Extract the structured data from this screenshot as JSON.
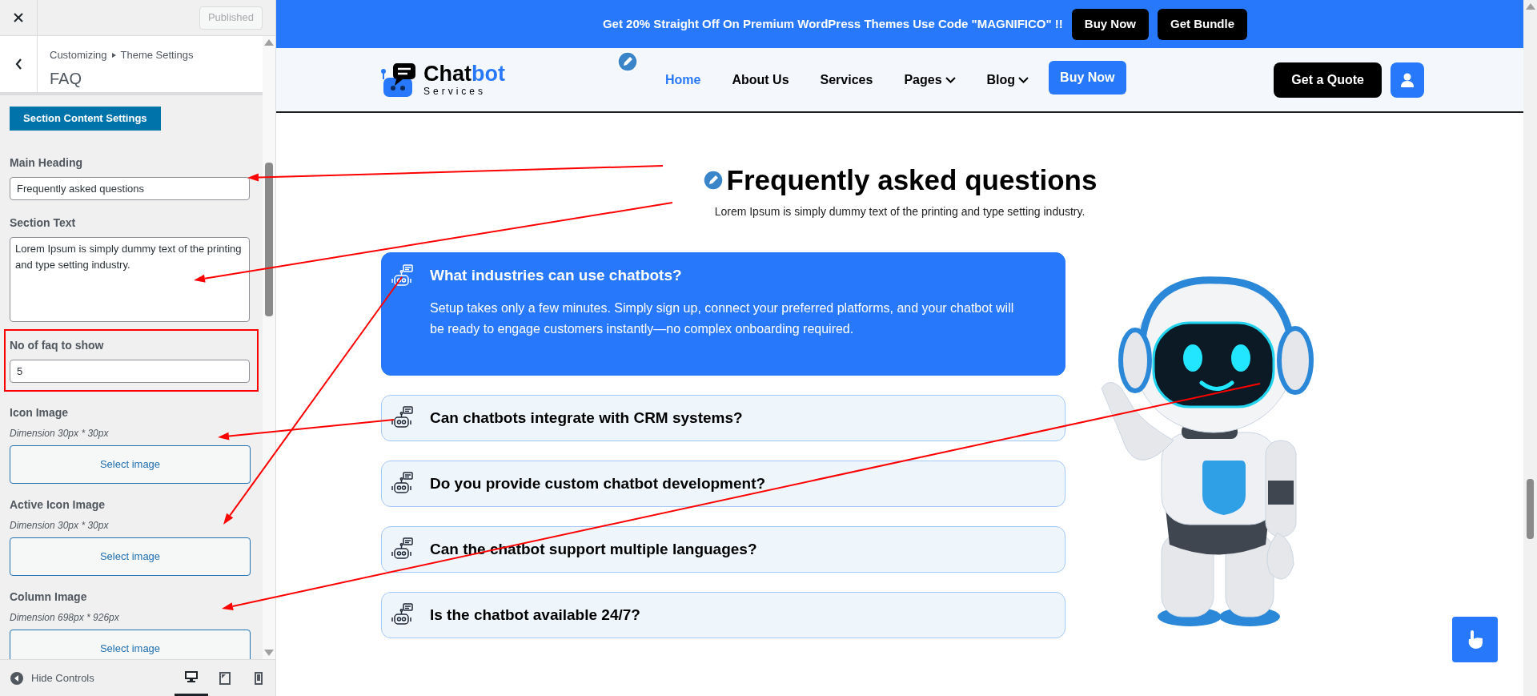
{
  "customizer": {
    "published_button": "Published",
    "breadcrumb": [
      "Customizing",
      "Theme Settings"
    ],
    "title": "FAQ",
    "section_button": "Section Content Settings",
    "main_heading": {
      "label": "Main Heading",
      "value": "Frequently asked questions"
    },
    "section_text": {
      "label": "Section Text",
      "value": "Lorem Ipsum is simply dummy text of the printing and type setting industry."
    },
    "faq_count": {
      "label": "No of faq to show",
      "value": "5",
      "highlighted": true
    },
    "image_fields": [
      {
        "label": "Icon Image",
        "hint": "Dimension 30px * 30px",
        "button": "Select image"
      },
      {
        "label": "Active Icon Image",
        "hint": "Dimension 30px * 30px",
        "button": "Select image"
      },
      {
        "label": "Column Image",
        "hint": "Dimension 698px * 926px",
        "button": "Select image"
      }
    ],
    "hide_controls": "Hide Controls",
    "devices": [
      {
        "kind": "desktop",
        "selected": true
      },
      {
        "kind": "tablet",
        "selected": false
      },
      {
        "kind": "mobile",
        "selected": false
      }
    ]
  },
  "site": {
    "promo": {
      "text": "Get 20% Straight Off On Premium WordPress Themes Use Code \"MAGNIFICO\" !!",
      "buttons": [
        "Buy Now",
        "Get Bundle"
      ]
    },
    "logo": {
      "name_start": "Chat",
      "name_end": "bot",
      "tagline": "Services"
    },
    "nav": [
      {
        "label": "Home",
        "selected": true,
        "dropdown": false
      },
      {
        "label": "About Us",
        "selected": false,
        "dropdown": false
      },
      {
        "label": "Services",
        "selected": false,
        "dropdown": false
      },
      {
        "label": "Pages",
        "selected": false,
        "dropdown": true
      },
      {
        "label": "Blog",
        "selected": false,
        "dropdown": true
      }
    ],
    "buy_now": "Buy Now",
    "quote_button": "Get a Quote",
    "faq": {
      "heading": "Frequently asked questions",
      "text": "Lorem Ipsum is simply dummy text of the printing and type setting industry.",
      "items": [
        {
          "question": "What industries can use chatbots?",
          "answer": "Setup takes only a few minutes. Simply sign up, connect your preferred platforms, and your chatbot will be ready to engage customers instantly—no complex onboarding required.",
          "expanded": true
        },
        {
          "question": "Can chatbots integrate with CRM systems?",
          "expanded": false
        },
        {
          "question": "Do you provide custom chatbot development?",
          "expanded": false
        },
        {
          "question": "Can the chatbot support multiple languages?",
          "expanded": false
        },
        {
          "question": "Is the chatbot available 24/7?",
          "expanded": false
        }
      ]
    }
  }
}
